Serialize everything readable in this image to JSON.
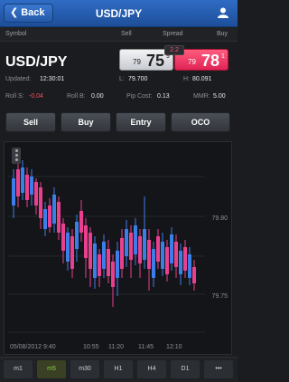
{
  "header": {
    "back_label": "Back",
    "title": "USD/JPY",
    "user_icon": "user-icon"
  },
  "columns": {
    "symbol": "Symbol",
    "sell": "Sell",
    "spread": "Spread",
    "buy": "Buy"
  },
  "quote": {
    "pair": "USD/JPY",
    "spread": "2.2",
    "sell": {
      "prefix": "79",
      "big": "75",
      "pip": "9"
    },
    "buy": {
      "prefix": "79",
      "big": "78",
      "pip": "1"
    },
    "sell_color": "#e8e8ea",
    "buy_color": "#f0345f"
  },
  "info": {
    "updated_label": "Updated:",
    "updated_value": "12:30:01",
    "low_label": "L:",
    "low_value": "79.700",
    "high_label": "H:",
    "high_value": "80.091",
    "roll_s_label": "Roll S:",
    "roll_s_value": "-0.04",
    "roll_b_label": "Roll B:",
    "roll_b_value": "0.00",
    "pip_cost_label": "Pip Cost:",
    "pip_cost_value": "0.13",
    "mmr_label": "MMR:",
    "mmr_value": "5.00"
  },
  "actions": [
    "Sell",
    "Buy",
    "Entry",
    "OCO"
  ],
  "chart": {
    "price_labels": [
      "79.80",
      "79.75"
    ],
    "time_labels": [
      "05/08/2012 9:40",
      "10:55",
      "11:20",
      "11:45",
      "12:10"
    ],
    "bull_color": "#3b7ee8",
    "bear_color": "#e8408f"
  },
  "timeframes": {
    "items": [
      "m1",
      "m5",
      "m30",
      "H1",
      "H4",
      "D1",
      "•••"
    ],
    "active": "m5"
  }
}
